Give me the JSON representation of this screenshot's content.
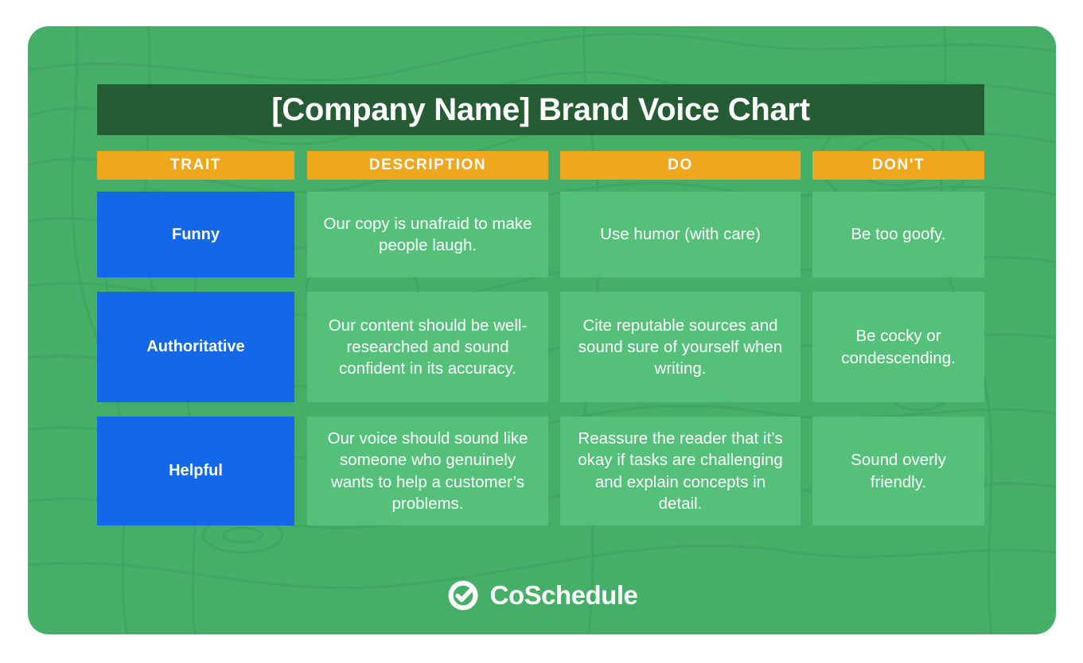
{
  "document": {
    "title": "[Company Name] Brand Voice Chart",
    "card_background_color": "#45AF68",
    "title_bar_color": "#265C33",
    "header_color": "#EFA71D",
    "trait_color": "#1268E8",
    "cell_color": "#55C07A",
    "text_color": "#FFFFFF"
  },
  "table": {
    "columns": [
      {
        "key": "trait",
        "label": "TRAIT"
      },
      {
        "key": "description",
        "label": "DESCRIPTION"
      },
      {
        "key": "do",
        "label": "DO"
      },
      {
        "key": "dont",
        "label": "DON'T"
      }
    ],
    "rows": [
      {
        "trait": "Funny",
        "description": "Our copy is unafraid to make people laugh.",
        "do": "Use humor (with care)",
        "dont": "Be too goofy."
      },
      {
        "trait": "Authoritative",
        "description": "Our content should be well-researched and sound confident in its accuracy.",
        "do": "Cite reputable sources and sound sure of yourself when writing.",
        "dont": "Be cocky or condescending."
      },
      {
        "trait": "Helpful",
        "description": "Our voice should sound like someone who genuinely wants to help a customer’s problems.",
        "do": "Reassure the reader that it’s okay if tasks are challenging and explain concepts in detail.",
        "dont": "Sound overly friendly."
      }
    ]
  },
  "footer": {
    "brand_name": "CoSchedule",
    "logo_icon": "circle-check-icon"
  }
}
